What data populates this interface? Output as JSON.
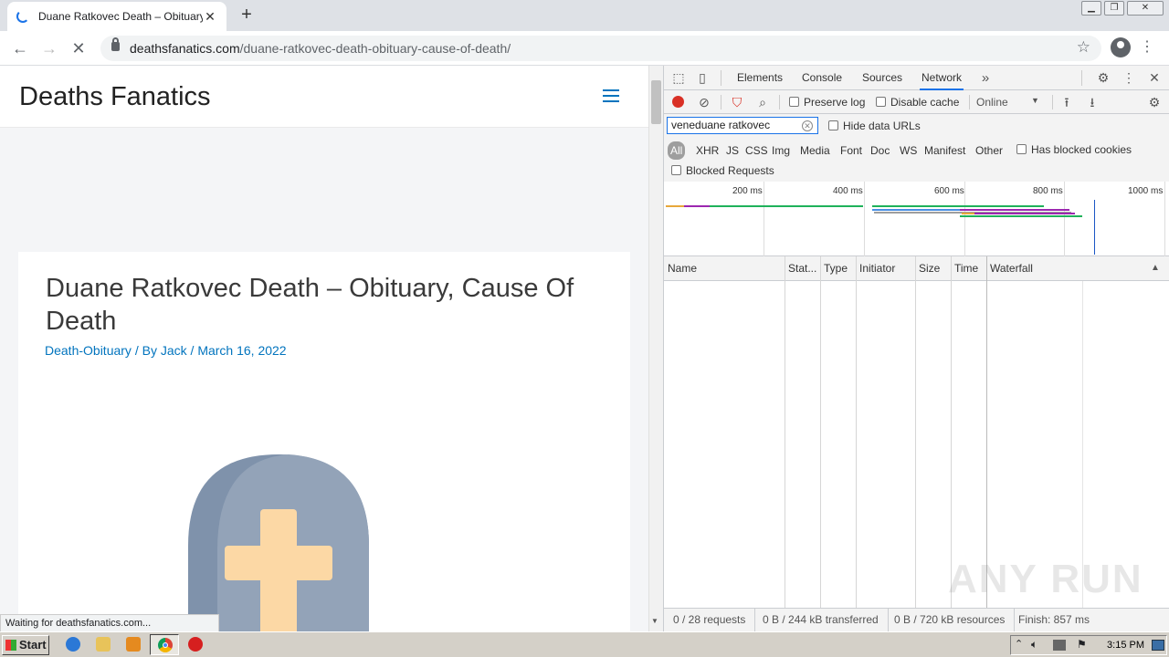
{
  "browser": {
    "tab_title": "Duane Ratkovec Death – Obituary, C",
    "tab_close": "✕",
    "new_tab": "+",
    "url_domain": "deathsfanatics.com",
    "url_path": "/duane-ratkovec-death-obituary-cause-of-death/",
    "status_text": "Waiting for deathsfanatics.com..."
  },
  "site": {
    "title": "Deaths Fanatics",
    "post_title": "Duane Ratkovec Death – Obituary, Cause Of Death",
    "category": "Death-Obituary",
    "by_prefix": " / By ",
    "author": "Jack",
    "date_sep": " / ",
    "date": "March 16, 2022"
  },
  "devtools": {
    "tabs": [
      "Elements",
      "Console",
      "Sources",
      "Network"
    ],
    "active_tab": "Network",
    "more": "»",
    "preserve_log": "Preserve log",
    "disable_cache": "Disable cache",
    "throttle": "Online",
    "filter_value": "veneduane ratkovec",
    "hide_data_urls": "Hide data URLs",
    "resource_types": [
      "All",
      "XHR",
      "JS",
      "CSS",
      "Img",
      "Media",
      "Font",
      "Doc",
      "WS",
      "Manifest",
      "Other"
    ],
    "has_blocked_cookies": "Has blocked cookies",
    "blocked_requests": "Blocked Requests",
    "timeline_ticks": [
      "200 ms",
      "400 ms",
      "600 ms",
      "800 ms",
      "1000 ms"
    ],
    "columns": [
      "Name",
      "Stat...",
      "Type",
      "Initiator",
      "Size",
      "Time",
      "Waterfall"
    ],
    "summary": {
      "requests": "0 / 28 requests",
      "transferred": "0 B / 244 kB transferred",
      "resources": "0 B / 720 kB resources",
      "finish": "Finish: 857 ms"
    }
  },
  "watermark": "ANY RUN",
  "taskbar": {
    "start": "Start",
    "clock": "3:15 PM"
  },
  "colors": {
    "accent": "#1a73e8",
    "link": "#0274be",
    "record": "#d93025"
  }
}
